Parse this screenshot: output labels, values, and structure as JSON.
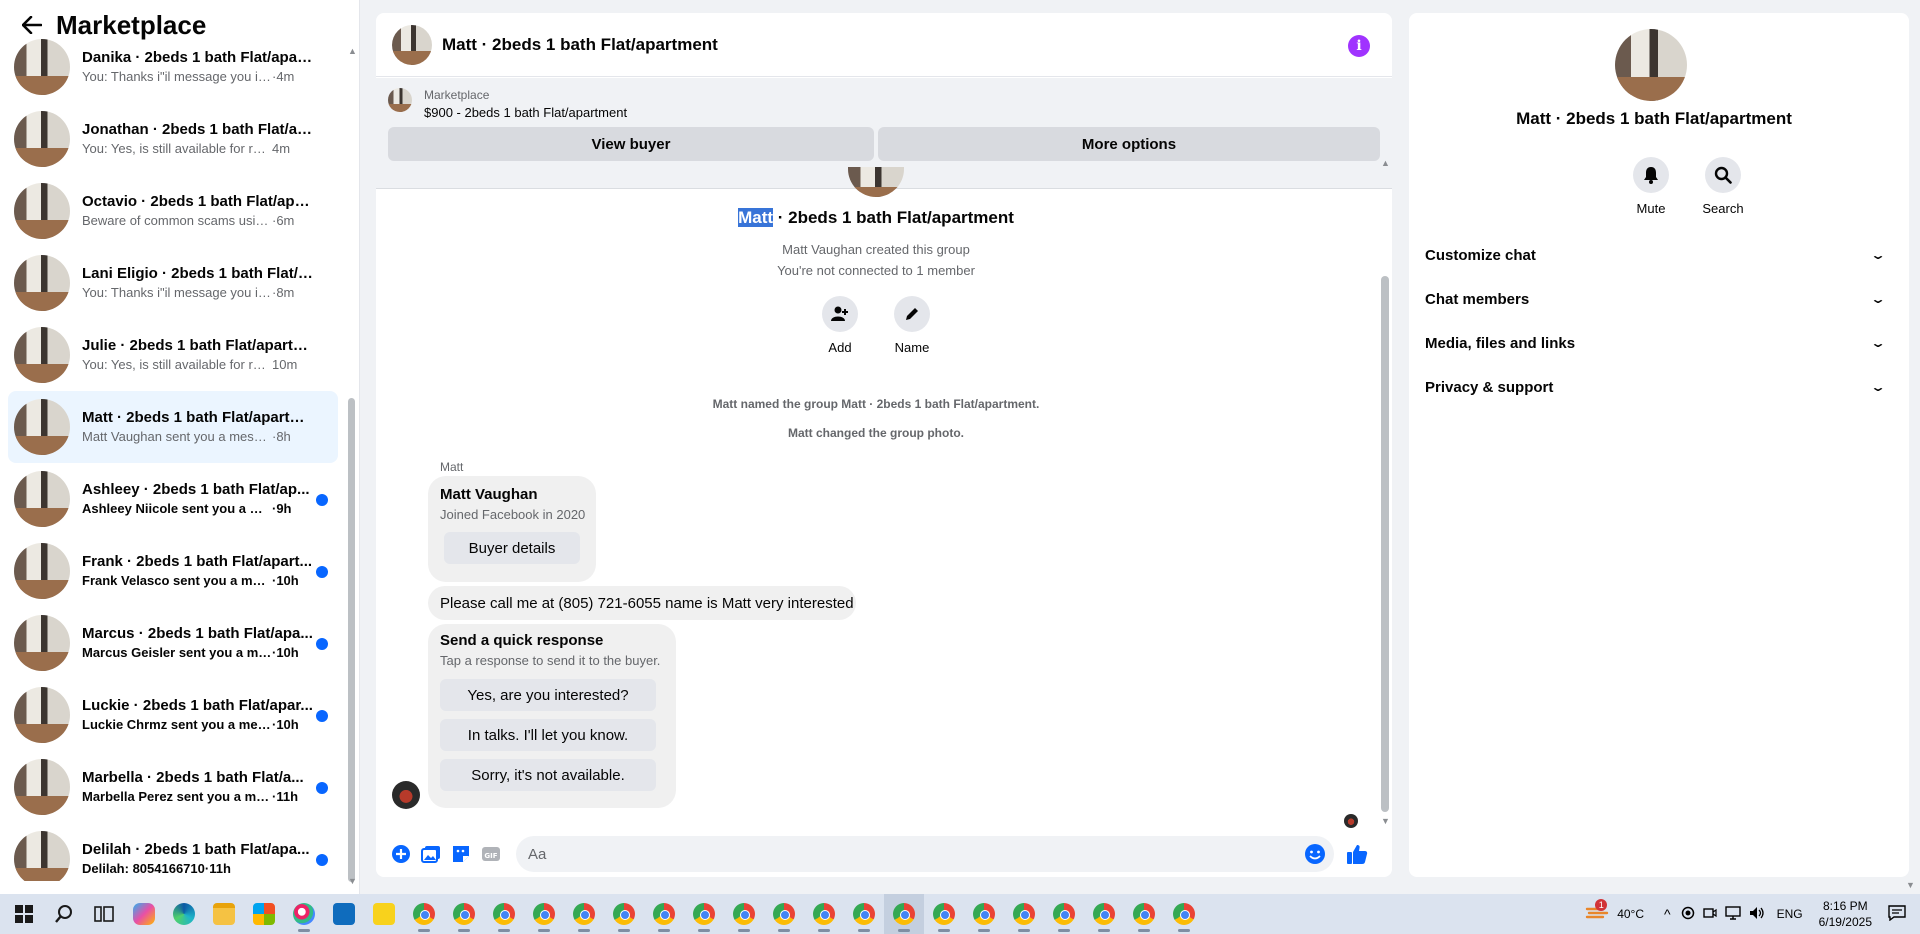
{
  "sidebar": {
    "title": "Marketplace",
    "conversations": [
      {
        "name": "Danika · 2beds 1 bath Flat/apart...",
        "preview": "You: Thanks i\"il message you in a ...",
        "time": "·4m",
        "unread": false,
        "selected": false
      },
      {
        "name": "Jonathan · 2beds 1 bath Flat/apa...",
        "preview": "You: Yes, is still available for rent. P...",
        "time": "4m",
        "unread": false,
        "selected": false
      },
      {
        "name": "Octavio · 2beds 1 bath Flat/apar...",
        "preview": "Beware of common scams using p...",
        "time": "·6m",
        "unread": false,
        "selected": false
      },
      {
        "name": "Lani Eligio · 2beds 1 bath Flat/ap...",
        "preview": "You: Thanks i\"il message you in a ...",
        "time": "·8m",
        "unread": false,
        "selected": false
      },
      {
        "name": "Julie · 2beds 1 bath Flat/apartme...",
        "preview": "You: Yes, is still available for rent. ...",
        "time": "10m",
        "unread": false,
        "selected": false
      },
      {
        "name": "Matt · 2beds 1 bath Flat/apartm...",
        "preview": "Matt Vaughan sent you a message ...",
        "time": "·8h",
        "unread": false,
        "selected": true
      },
      {
        "name": "Ashleey · 2beds 1 bath Flat/ap...",
        "preview": "Ashleey Niicole sent you a mess...",
        "time": "·9h",
        "unread": true,
        "selected": false
      },
      {
        "name": "Frank · 2beds 1 bath Flat/apart...",
        "preview": "Frank Velasco sent you a mess...",
        "time": "·10h",
        "unread": true,
        "selected": false
      },
      {
        "name": "Marcus · 2beds 1 bath Flat/apa...",
        "preview": "Marcus Geisler sent you a mess...",
        "time": "·10h",
        "unread": true,
        "selected": false
      },
      {
        "name": "Luckie · 2beds 1 bath Flat/apar...",
        "preview": "Luckie Chrmz sent you a messa...",
        "time": "·10h",
        "unread": true,
        "selected": false
      },
      {
        "name": "Marbella · 2beds 1 bath Flat/a...",
        "preview": "Marbella Perez sent you a mes...",
        "time": "·11h",
        "unread": true,
        "selected": false
      },
      {
        "name": "Delilah · 2beds 1 bath Flat/apa...",
        "preview": "Delilah: 8054166710",
        "time": "·11h",
        "unread": true,
        "selected": false
      }
    ]
  },
  "chat": {
    "title": "Matt · 2beds 1 bath Flat/apartment",
    "listing": {
      "source": "Marketplace",
      "price_title": "$900 - 2beds 1 bath Flat/apartment"
    },
    "buttons": {
      "view_buyer": "View buyer",
      "more_options": "More options"
    },
    "group": {
      "title_highlight": "Matt",
      "title_rest": " · 2beds 1 bath Flat/apartment",
      "created": "Matt Vaughan created this group",
      "connected": "You're not connected to 1 member",
      "add_label": "Add",
      "name_label": "Name"
    },
    "system_messages": [
      "Matt named the group Matt · 2beds 1 bath Flat/apartment.",
      "Matt changed the group photo."
    ],
    "sender_label": "Matt",
    "profile_card": {
      "name": "Matt Vaughan",
      "joined": "Joined Facebook in 2020",
      "button": "Buyer details"
    },
    "message": "Please call me at (805) 721-6055 name is Matt very interested",
    "quick_response": {
      "title": "Send a quick response",
      "subtitle": "Tap a response to send it to the buyer.",
      "options": [
        "Yes, are you interested?",
        "In talks. I'll let you know.",
        "Sorry, it's not available."
      ]
    },
    "composer_placeholder": "Aa"
  },
  "details": {
    "title": "Matt · 2beds 1 bath Flat/apartment",
    "mute_label": "Mute",
    "search_label": "Search",
    "sections": [
      "Customize chat",
      "Chat members",
      "Media, files and links",
      "Privacy & support"
    ]
  },
  "taskbar": {
    "weather": "40°C",
    "notification_badge": "1",
    "language": "ENG",
    "time": "8:16 PM",
    "date": "6/19/2025"
  },
  "colors": {
    "accent": "#0866ff",
    "info": "#a033ff",
    "selected_row": "#ebf5ff",
    "highlight": "#3874d8"
  }
}
